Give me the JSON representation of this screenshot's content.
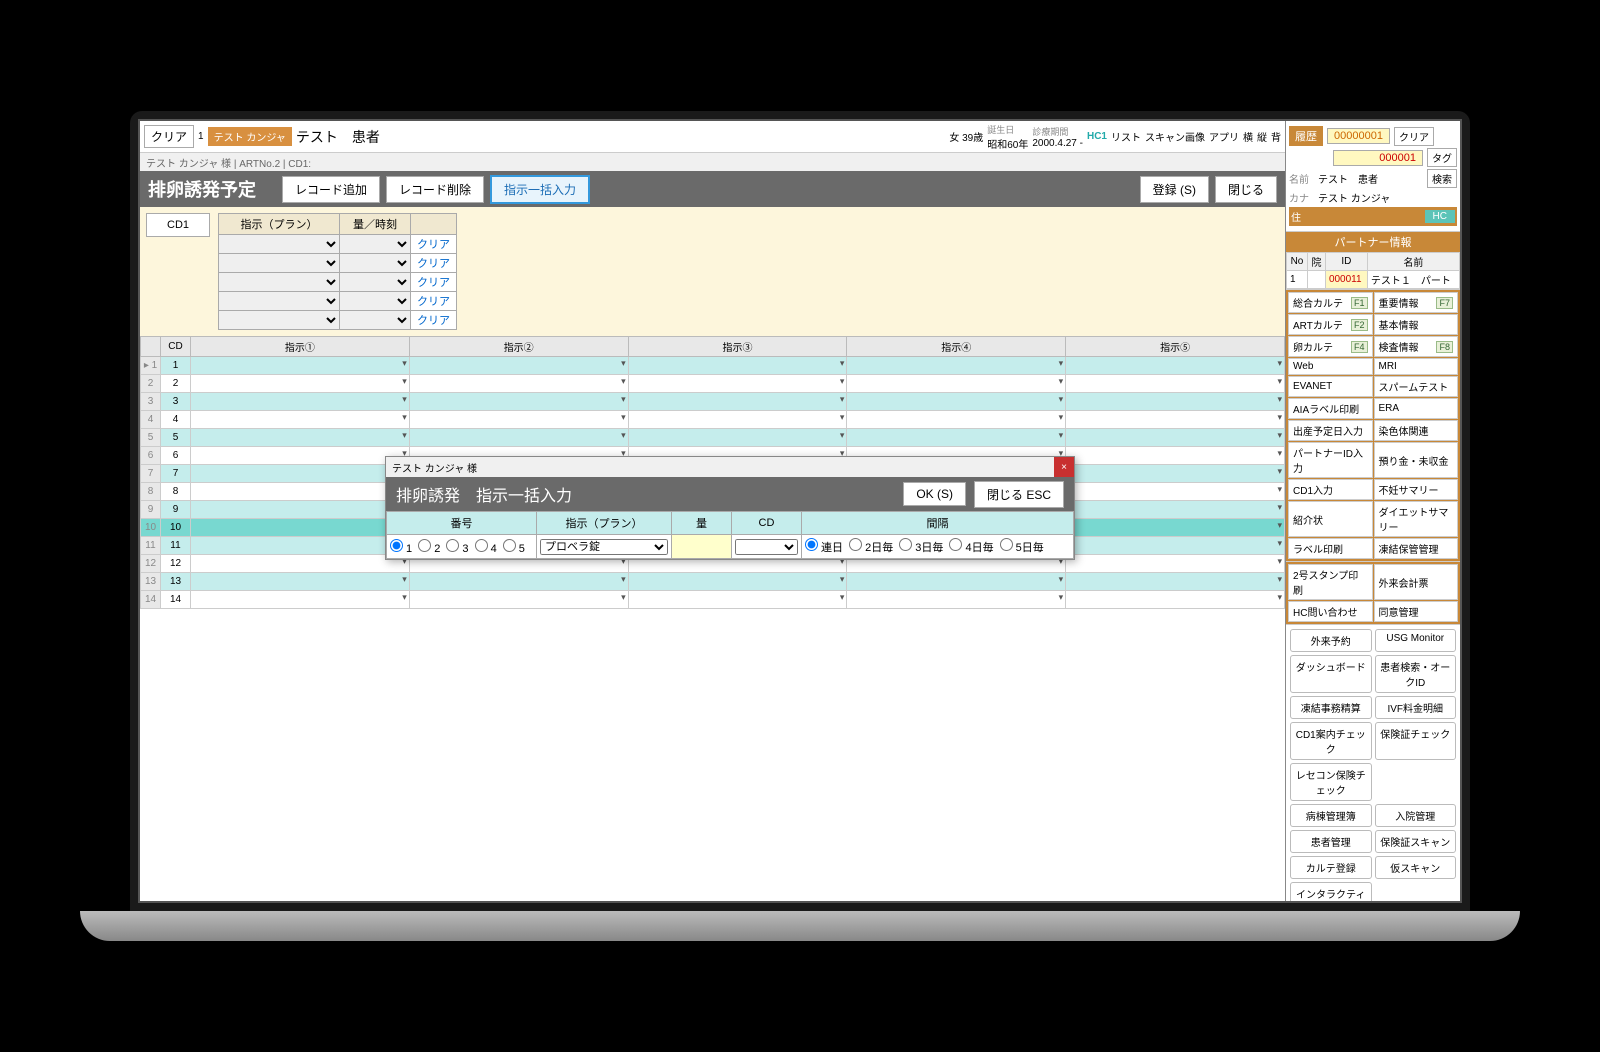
{
  "header": {
    "clear": "クリア",
    "id": "1",
    "name_kana": "テスト カンジャ",
    "name": "テスト　患者",
    "gender_age": "女 39歳",
    "birth_label": "誕生日",
    "birth": "昭和60年",
    "period_label": "診療期間",
    "period": "2000.4.27 -",
    "hc": "HC1",
    "list": "リスト",
    "scan": "スキャン画像",
    "app": "アプリ",
    "yoko": "横",
    "tate": "縦",
    "hai": "背"
  },
  "breadcrumb": "テスト カンジャ 様 | ARTNo.2 | CD1:",
  "titlebar": {
    "title": "排卵誘発予定",
    "add_record": "レコード追加",
    "del_record": "レコード削除",
    "batch_input": "指示一括入力",
    "register": "登録 (S)",
    "close": "閉じる"
  },
  "config": {
    "cd_label": "CD1",
    "col_plan": "指示（プラン）",
    "col_qty": "量／時刻",
    "clear": "クリア"
  },
  "grid": {
    "headers": [
      "",
      "CD",
      "指示①",
      "指示②",
      "指示③",
      "指示④",
      "指示⑤"
    ],
    "rows": [
      1,
      2,
      3,
      4,
      5,
      6,
      7,
      8,
      9,
      10,
      11,
      12,
      13,
      14
    ]
  },
  "modal": {
    "window_title": "テスト カンジャ 様",
    "title": "排卵誘発　指示一括入力",
    "ok": "OK (S)",
    "close": "閉じる ESC",
    "col_num": "番号",
    "col_plan": "指示（プラン）",
    "col_qty": "量",
    "col_cd": "CD",
    "col_interval": "間隔",
    "numbers": [
      "1",
      "2",
      "3",
      "4",
      "5"
    ],
    "plan_selected": "プロベラ錠",
    "intervals": [
      "連日",
      "2日毎",
      "3日毎",
      "4日毎",
      "5日毎"
    ]
  },
  "right": {
    "history": "履歴",
    "history_id": "00000001",
    "clear": "クリア",
    "tag": "タグ",
    "search": "検索",
    "id_field": "000001",
    "name_label": "名前",
    "name": "テスト　患者",
    "kana_label": "カナ",
    "kana": "テスト カンジャ",
    "addr_label": "住",
    "hc": "HC",
    "partner_title": "パートナー情報",
    "partner_headers": [
      "No",
      "院",
      "ID",
      "名前"
    ],
    "partner_row": [
      "1",
      "",
      "000011",
      "テスト１　パート"
    ],
    "menu": [
      {
        "l": "総合カルテ",
        "lk": "F1",
        "r": "重要情報",
        "rk": "F7"
      },
      {
        "l": "ARTカルテ",
        "lk": "F2",
        "r": "基本情報",
        "rk": ""
      },
      {
        "l": "卵カルテ",
        "lk": "F4",
        "r": "検査情報",
        "rk": "F8"
      },
      {
        "l": "Web",
        "lk": "",
        "r": "MRI",
        "rk": ""
      },
      {
        "l": "EVANET",
        "lk": "",
        "r": "スパームテスト",
        "rk": ""
      },
      {
        "l": "AIAラベル印刷",
        "lk": "",
        "r": "ERA",
        "rk": ""
      },
      {
        "l": "出産予定日入力",
        "lk": "",
        "r": "染色体関連",
        "rk": ""
      },
      {
        "l": "パートナーID入力",
        "lk": "",
        "r": "預り金・未収金",
        "rk": ""
      },
      {
        "l": "CD1入力",
        "lk": "",
        "r": "不妊サマリー",
        "rk": ""
      },
      {
        "l": "紹介状",
        "lk": "",
        "r": "ダイエットサマリー",
        "rk": ""
      },
      {
        "l": "ラベル印刷",
        "lk": "",
        "r": "凍結保管管理",
        "rk": ""
      }
    ],
    "menu2": [
      {
        "l": "2号スタンプ印刷",
        "r": "外来会計票"
      },
      {
        "l": "HC問い合わせ",
        "r": "同意管理"
      }
    ],
    "buttons": [
      [
        "外来予約",
        "USG Monitor"
      ],
      [
        "ダッシュボード",
        "患者検索・オークID"
      ],
      [
        "凍結事務精算",
        "IVF料金明細"
      ],
      [
        "CD1案内チェック",
        "保険証チェック"
      ],
      [
        "レセコン保険チェック",
        ""
      ],
      [
        "病棟管理簿",
        "入院管理"
      ],
      [
        "患者管理",
        "保険証スキャン"
      ],
      [
        "カルテ登録",
        "仮スキャン"
      ],
      [
        "インタラクティブメモ",
        ""
      ]
    ]
  }
}
